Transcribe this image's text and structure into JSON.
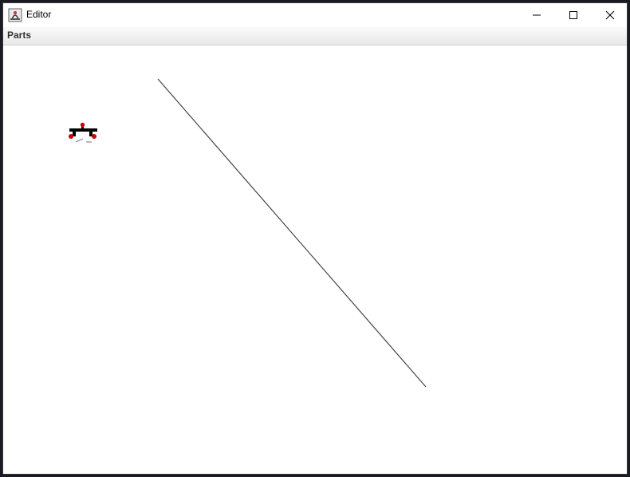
{
  "window": {
    "title": "Editor"
  },
  "menubar": {
    "items": [
      {
        "label": "Parts"
      }
    ]
  },
  "colors": {
    "line": "#444444",
    "part_body": "#000000",
    "part_terminal": "#cc0000"
  },
  "icons": {
    "app": "java-app-icon",
    "minimize": "minimize-icon",
    "maximize": "maximize-icon",
    "close": "close-icon"
  }
}
